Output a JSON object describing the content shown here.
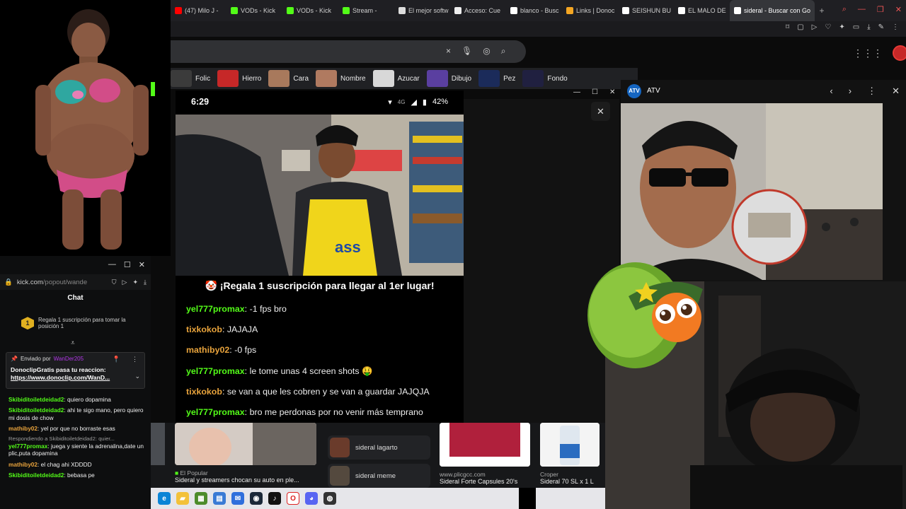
{
  "browser": {
    "tabs": [
      {
        "label": "(47) Milo J -",
        "color": "#ff0000"
      },
      {
        "label": "VODs - Kick",
        "color": "#53fc18"
      },
      {
        "label": "VODs - Kick",
        "color": "#53fc18"
      },
      {
        "label": "Stream -",
        "color": "#53fc18"
      },
      {
        "label": "El mejor softw",
        "color": "#dddddd"
      },
      {
        "label": "Acceso: Cue",
        "color": "#eeeeee"
      },
      {
        "label": "blanco - Busc",
        "color": "#ffffff"
      },
      {
        "label": "Links | Donoc",
        "color": "#f4a623"
      },
      {
        "label": "SEISHUN BU",
        "color": "#ffffff"
      },
      {
        "label": "EL MALO DE",
        "color": "#ffffff"
      }
    ],
    "active_tab": "sideral - Buscar con Go",
    "new_tab": "+",
    "chips": [
      "Folic",
      "Hierro",
      "Cara",
      "Nombre",
      "Azucar",
      "Dibujo",
      "Pez",
      "Fondo"
    ],
    "search_clear": "×"
  },
  "chat": {
    "url_main": "kick.com",
    "url_rest": "/popout/wande",
    "title": "Chat",
    "promo_badge": "1",
    "promo_text": "Regala 1 suscripción para tomar la posición 1",
    "pinned": {
      "sent_by": "Enviado por",
      "user": "WanDer205",
      "body": "DonoclipGratis pasa tu reaccion:",
      "link": "https://www.donoclip.com/WanD..."
    },
    "messages": [
      {
        "user": "Skibiditoiletdeidad2",
        "color": "#53fc18",
        "text": "quiero dopamina"
      },
      {
        "user": "Skibiditoiletdeidad2",
        "color": "#53fc18",
        "text": "ahi te sigo mano, pero quiero mi dosis de chow"
      },
      {
        "user": "mathiby02",
        "color": "#e8a33c",
        "text": "yel por que no borraste esas"
      },
      {
        "user": "yel777promax",
        "color": "#53fc18",
        "reply": "Respondiendo a Skibiditoiletdeidad2: quier...",
        "text": "juega y siente la adrenalina,date un plic,puta dopamina"
      },
      {
        "user": "mathiby02",
        "color": "#e8a33c",
        "text": "el chag ahi XDDDD"
      },
      {
        "user": "Skibiditoiletdeidad2",
        "color": "#53fc18",
        "text": "bebasa pe"
      }
    ]
  },
  "phone": {
    "time": "6:29",
    "network": "4G",
    "battery": "42%",
    "sub_banner": "🤡 ¡Regala 1 suscripción para llegar al 1er lugar!",
    "messages": [
      {
        "user": "yel777promax",
        "color": "#53fc18",
        "text": "-1 fps bro"
      },
      {
        "user": "tixkokob",
        "color": "#e8a33c",
        "text": "JAJAJA"
      },
      {
        "user": "mathiby02",
        "color": "#e8a33c",
        "text": "-0 fps"
      },
      {
        "user": "yel777promax",
        "color": "#53fc18",
        "text": "le tome unas 4 screen shots 🤑"
      },
      {
        "user": "tixkokob",
        "color": "#e8a33c",
        "text": "se van a que les cobren y se van a guardar JAJQJA"
      },
      {
        "user": "yel777promax",
        "color": "#53fc18",
        "text": "bro me perdonas por no venir más temprano"
      }
    ]
  },
  "atv": {
    "title": "ATV",
    "logo": "ATV"
  },
  "results": {
    "card1_source": "El Popular",
    "card1_title": "Sideral y streamers chocan su auto en ple...",
    "related1": "sideral lagarto",
    "related2": "sideral meme",
    "card3_source": "www.plicgcc.com",
    "card3_title": "Sideral Forte Capsules 20's",
    "card4_source": "Croper",
    "card4_title": "Sideral 70 SL x 1 L"
  },
  "colors": {
    "kick_green": "#53fc18",
    "accent_red": "#e53935"
  }
}
